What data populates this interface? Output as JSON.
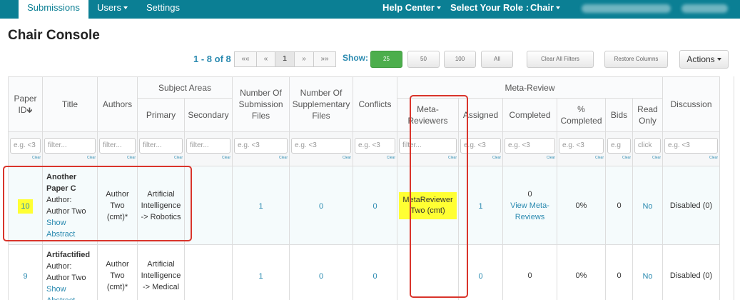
{
  "nav": {
    "tabs": [
      "Submissions",
      "Users",
      "Settings"
    ],
    "help_center": "Help Center",
    "select_role_label": "Select Your Role :",
    "role": "Chair"
  },
  "page_title": "Chair Console",
  "toolbar": {
    "page_info": "1 - 8 of 8",
    "pager": [
      "««",
      "«",
      "1",
      "»",
      "»»"
    ],
    "show_label": "Show:",
    "show_options": [
      "25",
      "50",
      "100",
      "All"
    ],
    "show_selected": "25",
    "clear_filters": "Clear All Filters",
    "restore_columns": "Restore Columns",
    "actions": "Actions"
  },
  "table": {
    "group_headers": {
      "subject_areas": "Subject Areas",
      "meta_review": "Meta-Review"
    },
    "headers": {
      "paper_id": "Paper ID",
      "title": "Title",
      "authors": "Authors",
      "primary": "Primary",
      "secondary": "Secondary",
      "submission_files": "Number Of Submission Files",
      "supplementary_files": "Number Of Supplementary Files",
      "conflicts": "Conflicts",
      "meta_reviewers": "Meta-Reviewers",
      "assigned": "Assigned",
      "completed": "Completed",
      "pct_completed": "% Completed",
      "bids": "Bids",
      "read_only": "Read Only",
      "discussion": "Discussion"
    },
    "filters": {
      "paper_id": "e.g. <3",
      "title": "filter...",
      "authors": "filter...",
      "primary": "filter...",
      "secondary": "filter...",
      "submission_files": "e.g. <3",
      "supplementary_files": "e.g. <3",
      "conflicts": "e.g. <3",
      "meta_reviewers": "filter...",
      "assigned": "e.g. <3",
      "completed": "e.g. <3",
      "pct_completed": "e.g. <3",
      "bids": "e.g",
      "read_only": "click",
      "discussion": "e.g. <3"
    },
    "clear_label": "Clear",
    "rows": [
      {
        "id": "10",
        "title": "Another Paper C",
        "author_label": "Author:",
        "author": "Author Two",
        "show_abstract": "Show Abstract",
        "authors": "Author Two (cmt)*",
        "primary": "Artificial Intelligence -> Robotics",
        "secondary": "",
        "submission_files": "1",
        "supplementary_files": "0",
        "conflicts": "0",
        "meta_reviewers": "MetaReviewer Two (cmt)",
        "assigned": "1",
        "completed": "0",
        "view_meta_reviews": "View Meta-Reviews",
        "pct_completed": "0%",
        "bids": "0",
        "read_only": "No",
        "discussion": "Disabled (0)"
      },
      {
        "id": "9",
        "title": "Artifactified",
        "author_label": "Author:",
        "author": "Author Two",
        "show_abstract": "Show Abstract",
        "authors": "Author Two (cmt)*",
        "primary": "Artificial Intelligence -> Medical",
        "secondary": "",
        "submission_files": "1",
        "supplementary_files": "0",
        "conflicts": "0",
        "meta_reviewers": "",
        "assigned": "0",
        "completed": "0",
        "pct_completed": "0%",
        "bids": "0",
        "read_only": "No",
        "discussion": "Disabled (0)"
      }
    ]
  }
}
